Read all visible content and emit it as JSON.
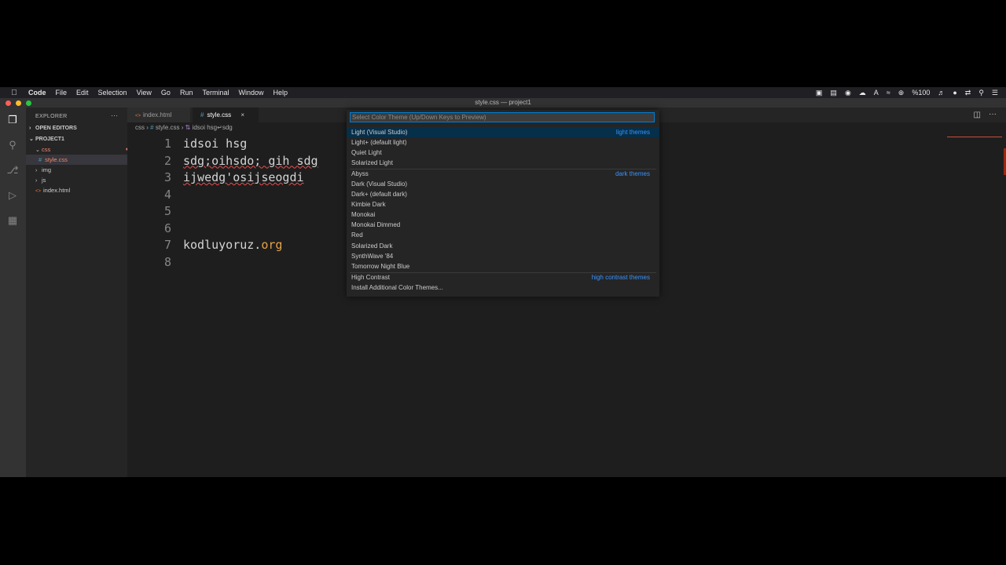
{
  "menubar": {
    "app": "Code",
    "items": [
      "File",
      "Edit",
      "Selection",
      "View",
      "Go",
      "Run",
      "Terminal",
      "Window",
      "Help"
    ],
    "battery": "%100"
  },
  "window": {
    "title": "style.css — project1"
  },
  "sidebar": {
    "title": "EXPLORER",
    "open_editors": "OPEN EDITORS",
    "project": "PROJECT1",
    "tree": {
      "css": "css",
      "style": "style.css",
      "style_badge": "3",
      "img": "img",
      "js": "js",
      "index": "index.html"
    }
  },
  "tabs": [
    {
      "label": "index.html"
    },
    {
      "label": "style.css"
    }
  ],
  "breadcrumb": {
    "folder": "css",
    "file": "style.css",
    "symbol": "idsoi hsg↵sdg"
  },
  "editor": {
    "line_numbers": [
      "1",
      "2",
      "3",
      "4",
      "5",
      "6",
      "7",
      "8"
    ],
    "lines": [
      "idsoi hsg",
      "sdg;oihsdo; gih sdg",
      "ijwedg'osijseogdi",
      "",
      "",
      "",
      "kodluyoruz.",
      ""
    ],
    "line7_ext": "org"
  },
  "quickpick": {
    "placeholder": "Select Color Theme (Up/Down Keys to Preview)",
    "groups": {
      "light": "light themes",
      "dark": "dark themes",
      "hc": "high contrast themes"
    },
    "items": [
      "Light (Visual Studio)",
      "Light+ (default light)",
      "Quiet Light",
      "Solarized Light",
      "Abyss",
      "Dark (Visual Studio)",
      "Dark+ (default dark)",
      "Kimbie Dark",
      "Monokai",
      "Monokai Dimmed",
      "Red",
      "Solarized Dark",
      "SynthWave '84",
      "Tomorrow Night Blue",
      "High Contrast",
      "Install Additional Color Themes..."
    ]
  },
  "colors": {
    "accent": "#007fd4",
    "selected_item": "#062f4a",
    "group_label": "#3794ff",
    "error": "#f48771"
  }
}
